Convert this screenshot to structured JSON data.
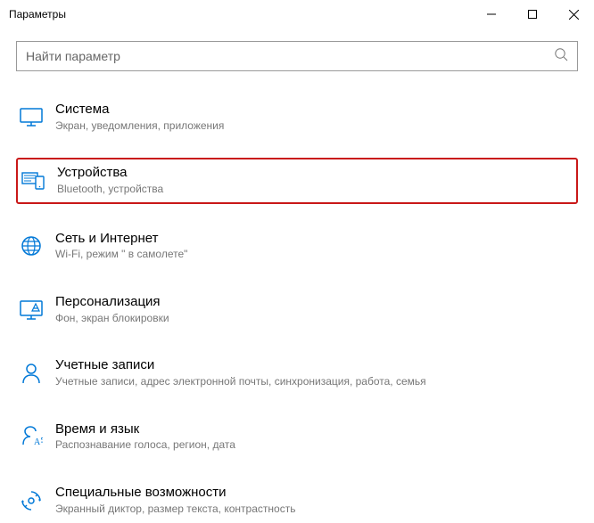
{
  "window": {
    "title": "Параметры"
  },
  "search": {
    "placeholder": "Найти параметр"
  },
  "categories": [
    {
      "key": "system",
      "title": "Система",
      "sub": "Экран, уведомления, приложения",
      "highlight": false
    },
    {
      "key": "devices",
      "title": "Устройства",
      "sub": "Bluetooth, устройства",
      "highlight": true
    },
    {
      "key": "network",
      "title": "Сеть и Интернет",
      "sub": "Wi-Fi, режим \" в самолете\"",
      "highlight": false
    },
    {
      "key": "personalization",
      "title": "Персонализация",
      "sub": "Фон, экран блокировки",
      "highlight": false
    },
    {
      "key": "accounts",
      "title": "Учетные записи",
      "sub": "Учетные записи, адрес электронной почты, синхронизация, работа, семья",
      "highlight": false
    },
    {
      "key": "time",
      "title": "Время и язык",
      "sub": "Распознавание голоса, регион, дата",
      "highlight": false
    },
    {
      "key": "ease",
      "title": "Специальные возможности",
      "sub": "Экранный диктор, размер текста, контрастность",
      "highlight": false
    }
  ]
}
